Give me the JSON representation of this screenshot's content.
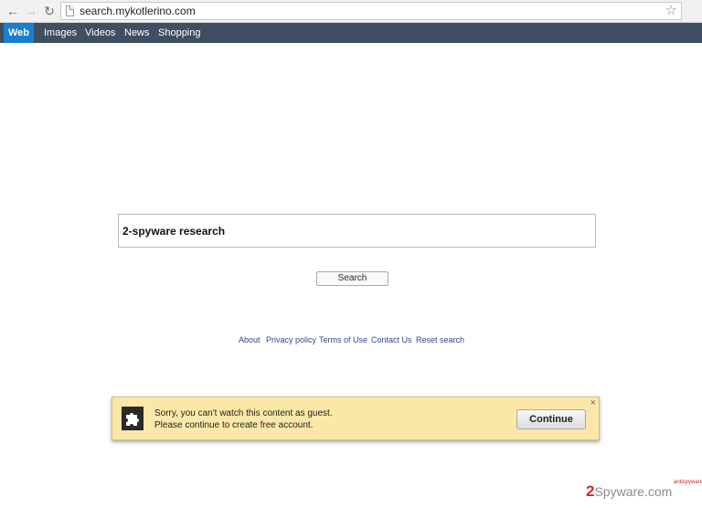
{
  "browser": {
    "url": "search.mykotlerino.com",
    "icons": {
      "back": "back-arrow-icon",
      "forward": "forward-arrow-icon",
      "reload": "reload-icon",
      "page": "page-icon",
      "bookmark": "star-icon"
    }
  },
  "nav": {
    "tabs": [
      {
        "label": "Web",
        "active": true
      },
      {
        "label": "Images",
        "active": false
      },
      {
        "label": "Videos",
        "active": false
      },
      {
        "label": "News",
        "active": false
      },
      {
        "label": "Shopping",
        "active": false
      }
    ],
    "colors": {
      "bar": "#3f4e60",
      "active": "#1a7ed0"
    }
  },
  "search": {
    "query": "2-spyware research",
    "button_label": "Search"
  },
  "footer": {
    "links": [
      "About",
      "Privacy policy",
      "Terms of Use",
      "Contact Us",
      "Reset search"
    ]
  },
  "popup": {
    "line1": "Sorry, you can't watch this content as guest.",
    "line2": "Please continue to create free account.",
    "button_label": "Continue",
    "close": "×",
    "icon": "puzzle-icon",
    "background": "#fbe8a8"
  },
  "watermark": {
    "brand_number": "2",
    "brand_text": "Spyware",
    "brand_tld": ".com",
    "badge": "antispyware"
  }
}
